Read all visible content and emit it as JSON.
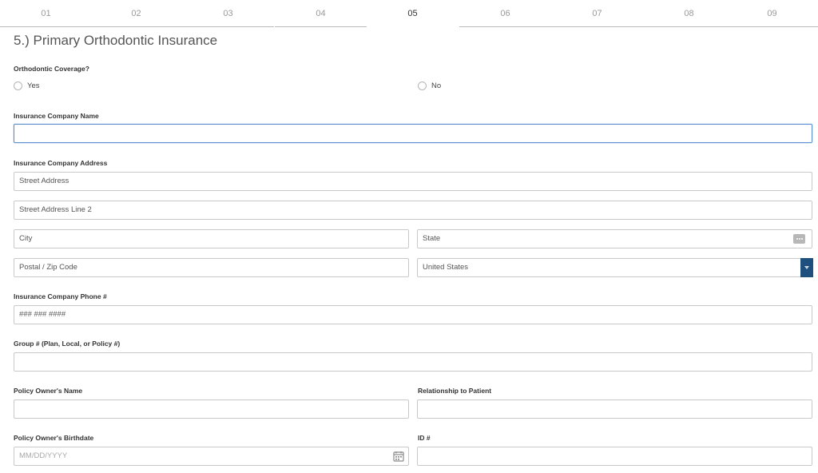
{
  "steps": [
    "01",
    "02",
    "03",
    "04",
    "05",
    "06",
    "07",
    "08",
    "09"
  ],
  "active_step": "05",
  "section_title": "5.) Primary Orthodontic Insurance",
  "coverage": {
    "label": "Orthodontic Coverage?",
    "options": [
      "Yes",
      "No"
    ]
  },
  "company_name": {
    "label": "Insurance Company Name",
    "value": ""
  },
  "address": {
    "label": "Insurance Company Address",
    "street": "Street Address",
    "street2": "Street Address Line 2",
    "city": "City",
    "state": "State",
    "postal": "Postal / Zip Code",
    "country": "United States"
  },
  "phone": {
    "label": "Insurance Company Phone #",
    "placeholder": "### ### ####"
  },
  "group": {
    "label": "Group # (Plan, Local, or Policy #)",
    "value": ""
  },
  "owner_name": {
    "label": "Policy Owner's Name",
    "value": ""
  },
  "relationship": {
    "label": "Relationship to Patient",
    "value": ""
  },
  "birthdate": {
    "label": "Policy Owner's Birthdate",
    "placeholder": "MM/DD/YYYY"
  },
  "id_number": {
    "label": "ID #",
    "value": ""
  },
  "icons": {
    "state": "more-icon",
    "birthdate": "calendar-icon",
    "country": "chevron-down-icon"
  },
  "colors": {
    "accent": "#1e4f7e",
    "focus_border": "#5a8ed0"
  }
}
